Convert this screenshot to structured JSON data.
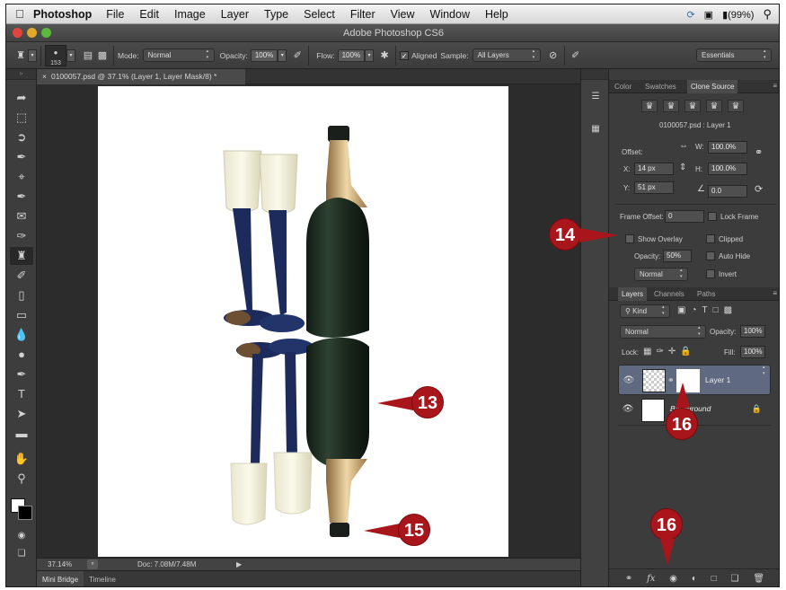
{
  "menubar": {
    "app_name": "Photoshop",
    "items": [
      "File",
      "Edit",
      "Image",
      "Layer",
      "Type",
      "Select",
      "Filter",
      "View",
      "Window",
      "Help"
    ],
    "battery": "(99%)"
  },
  "window": {
    "title": "Adobe Photoshop CS6"
  },
  "options": {
    "brush_size": "153",
    "mode_label": "Mode:",
    "mode_value": "Normal",
    "opacity_label": "Opacity:",
    "opacity_value": "100%",
    "flow_label": "Flow:",
    "flow_value": "100%",
    "aligned_label": "Aligned",
    "sample_label": "Sample:",
    "sample_value": "All Layers",
    "workspace": "Essentials"
  },
  "document": {
    "tab_title": "0100057.psd @ 37.1% (Layer 1, Layer Mask/8) *",
    "zoom": "37.14%",
    "doc_size": "Doc: 7.08M/7.48M"
  },
  "bottom_tabs": [
    "Mini Bridge",
    "Timeline"
  ],
  "clone_panel": {
    "tabs": [
      "Color",
      "Swatches",
      "Clone Source"
    ],
    "active_tab": "Clone Source",
    "source_name": "0100057.psd : Layer 1",
    "offset_label": "Offset:",
    "x_label": "X:",
    "x_value": "14 px",
    "y_label": "Y:",
    "y_value": "51 px",
    "w_label": "W:",
    "w_value": "100.0%",
    "h_label": "H:",
    "h_value": "100.0%",
    "angle_value": "0.0",
    "frame_offset_label": "Frame Offset:",
    "frame_offset_value": "0",
    "lock_frame_label": "Lock Frame",
    "show_overlay_label": "Show Overlay",
    "clipped_label": "Clipped",
    "opacity_label": "Opacity:",
    "opacity_value": "50%",
    "auto_hide_label": "Auto Hide",
    "blend_value": "Normal",
    "invert_label": "Invert"
  },
  "layers_panel": {
    "tabs": [
      "Layers",
      "Channels",
      "Paths"
    ],
    "active_tab": "Layers",
    "filter_label": "Kind",
    "blend_mode": "Normal",
    "opacity_label": "Opacity:",
    "opacity_value": "100%",
    "lock_label": "Lock:",
    "fill_label": "Fill:",
    "fill_value": "100%",
    "layers": [
      {
        "name": "Layer 1",
        "selected": true
      },
      {
        "name": "Background",
        "selected": false
      }
    ]
  },
  "callouts": [
    "14",
    "13",
    "15",
    "16",
    "16"
  ],
  "colors": {
    "callout": "#a8161c",
    "selection": "#5f6a80",
    "bottle": "#1f2c20",
    "stem": "#1c2b5c",
    "foil": "#c9a76f"
  }
}
